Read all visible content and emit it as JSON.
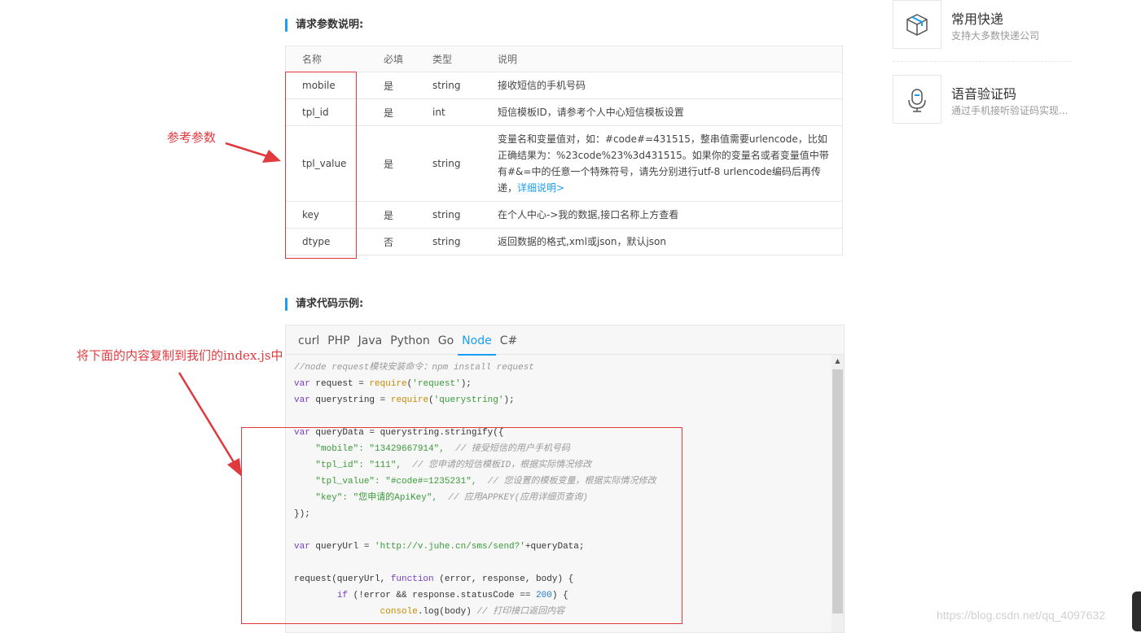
{
  "params_section": {
    "title": "请求参数说明:",
    "headers": [
      "名称",
      "必填",
      "类型",
      "说明"
    ],
    "rows": [
      {
        "name": "mobile",
        "required": "是",
        "type": "string",
        "desc": "接收短信的手机号码"
      },
      {
        "name": "tpl_id",
        "required": "是",
        "type": "int",
        "desc": "短信模板ID，请参考个人中心短信模板设置"
      },
      {
        "name": "tpl_value",
        "required": "是",
        "type": "string",
        "desc": "变量名和变量值对，如：#code#=431515，整串值需要urlencode，比如正确结果为：%23code%23%3d431515。如果你的变量名或者变量值中带有#&=中的任意一个特殊符号，请先分别进行utf-8 urlencode编码后再传递，",
        "link": "详细说明>"
      },
      {
        "name": "key",
        "required": "是",
        "type": "string",
        "desc": "在个人中心->我的数据,接口名称上方查看"
      },
      {
        "name": "dtype",
        "required": "否",
        "type": "string",
        "desc": "返回数据的格式,xml或json，默认json"
      }
    ]
  },
  "code_section": {
    "title": "请求代码示例:",
    "tabs": [
      "curl",
      "PHP",
      "Java",
      "Python",
      "Go",
      "Node",
      "C#"
    ],
    "active_tab": "Node",
    "lines": {
      "l1": "//node request模块安装命令：npm install request",
      "l2_kw": "var",
      "l2_a": " request = ",
      "l2_fn": "require",
      "l2_b": "(",
      "l2_str": "'request'",
      "l2_c": ");",
      "l3_kw": "var",
      "l3_a": " querystring = ",
      "l3_fn": "require",
      "l3_b": "(",
      "l3_str": "'querystring'",
      "l3_c": ");",
      "l5_kw": "var",
      "l5_a": " queryData = querystring.stringify({",
      "l6_str": "    \"mobile\": \"13429667914\",",
      "l6_cmt": "  // 接受短信的用户手机号码",
      "l7_str": "    \"tpl_id\": \"111\",",
      "l7_cmt": "  // 您申请的短信模板ID，根据实际情况修改",
      "l8_str": "    \"tpl_value\": \"#code#=1235231\",",
      "l8_cmt": "  // 您设置的模板变量，根据实际情况修改",
      "l9_str": "    \"key\": \"您申请的ApiKey\",",
      "l9_cmt": "  // 应用APPKEY(应用详细页查询)",
      "l10": "});",
      "l12_kw": "var",
      "l12_a": " queryUrl = ",
      "l12_str": "'http://v.juhe.cn/sms/send?'",
      "l12_b": "+queryData;",
      "l14_a": "request(queryUrl, ",
      "l14_kw": "function",
      "l14_b": " (error, response, body) {",
      "l15_a": "        ",
      "l15_kw": "if",
      "l15_b": " (!error && response.statusCode == ",
      "l15_num": "200",
      "l15_c": ") {",
      "l16_a": "                ",
      "l16_fn": "console",
      "l16_b": ".log(body)",
      "l16_cmt": " // 打印接口返回内容"
    }
  },
  "sidebar": {
    "cards": [
      {
        "title": "常用快递",
        "desc": "支持大多数快递公司",
        "icon": "package-icon"
      },
      {
        "title": "语音验证码",
        "desc": "通过手机接听验证码实现...",
        "icon": "microphone-icon"
      }
    ]
  },
  "annotations": {
    "params_note": "参考参数",
    "code_note": "将下面的内容复制到我们的index.js中"
  },
  "watermark": "https://blog.csdn.net/qq_4097632",
  "colors": {
    "accent": "#1a9df5",
    "annotation": "#e0393e"
  }
}
